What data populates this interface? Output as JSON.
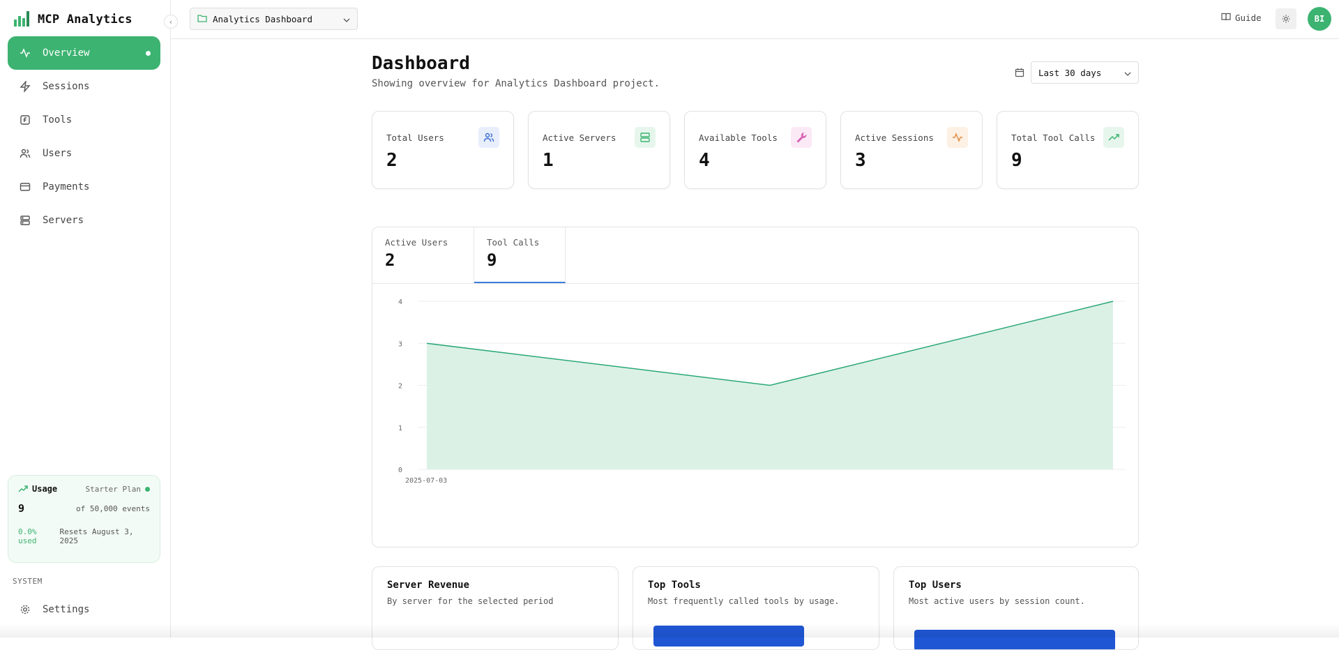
{
  "app": {
    "name": "MCP Analytics"
  },
  "sidebar": {
    "items": [
      {
        "label": "Overview",
        "icon": "activity-icon"
      },
      {
        "label": "Sessions",
        "icon": "zap-icon"
      },
      {
        "label": "Tools",
        "icon": "function-icon"
      },
      {
        "label": "Users",
        "icon": "users-icon"
      },
      {
        "label": "Payments",
        "icon": "credit-card-icon"
      },
      {
        "label": "Servers",
        "icon": "server-icon"
      }
    ],
    "usage": {
      "title": "Usage",
      "plan": "Starter Plan",
      "count": "9",
      "of_events": "of 50,000 events",
      "used": "0.0% used",
      "resets": "Resets August 3, 2025"
    },
    "system_label": "SYSTEM",
    "settings_label": "Settings"
  },
  "topbar": {
    "project": "Analytics Dashboard",
    "guide": "Guide",
    "avatar": "BI"
  },
  "page": {
    "title": "Dashboard",
    "subtitle": "Showing overview for Analytics Dashboard project.",
    "range": "Last 30 days"
  },
  "stats": [
    {
      "label": "Total Users",
      "value": "2",
      "icon": "users-icon",
      "color": "#3b6fd4",
      "bg": "#e8eefb"
    },
    {
      "label": "Active Servers",
      "value": "1",
      "icon": "server-icon",
      "color": "#3cb371",
      "bg": "#e6f6ec"
    },
    {
      "label": "Available Tools",
      "value": "4",
      "icon": "wrench-icon",
      "color": "#d65db1",
      "bg": "#fbe9f5"
    },
    {
      "label": "Active Sessions",
      "value": "3",
      "icon": "activity-icon",
      "color": "#e08a3c",
      "bg": "#fdf0e4"
    },
    {
      "label": "Total Tool Calls",
      "value": "9",
      "icon": "trending-up-icon",
      "color": "#3cb371",
      "bg": "#e6f6ec"
    }
  ],
  "chart_tabs": [
    {
      "label": "Active Users",
      "value": "2"
    },
    {
      "label": "Tool Calls",
      "value": "9"
    }
  ],
  "chart_data": {
    "type": "area",
    "x": [
      "2025-07-03",
      "",
      ""
    ],
    "values": [
      3,
      2,
      4
    ],
    "yticks": [
      "0",
      "1",
      "2",
      "3",
      "4"
    ],
    "ylim": [
      0,
      4
    ],
    "color": "#2aa876",
    "fill": "#dcf1e6"
  },
  "bottom_cards": [
    {
      "title": "Server Revenue",
      "subtitle": "By server for the selected period"
    },
    {
      "title": "Top Tools",
      "subtitle": "Most frequently called tools by usage."
    },
    {
      "title": "Top Users",
      "subtitle": "Most active users by session count."
    }
  ]
}
